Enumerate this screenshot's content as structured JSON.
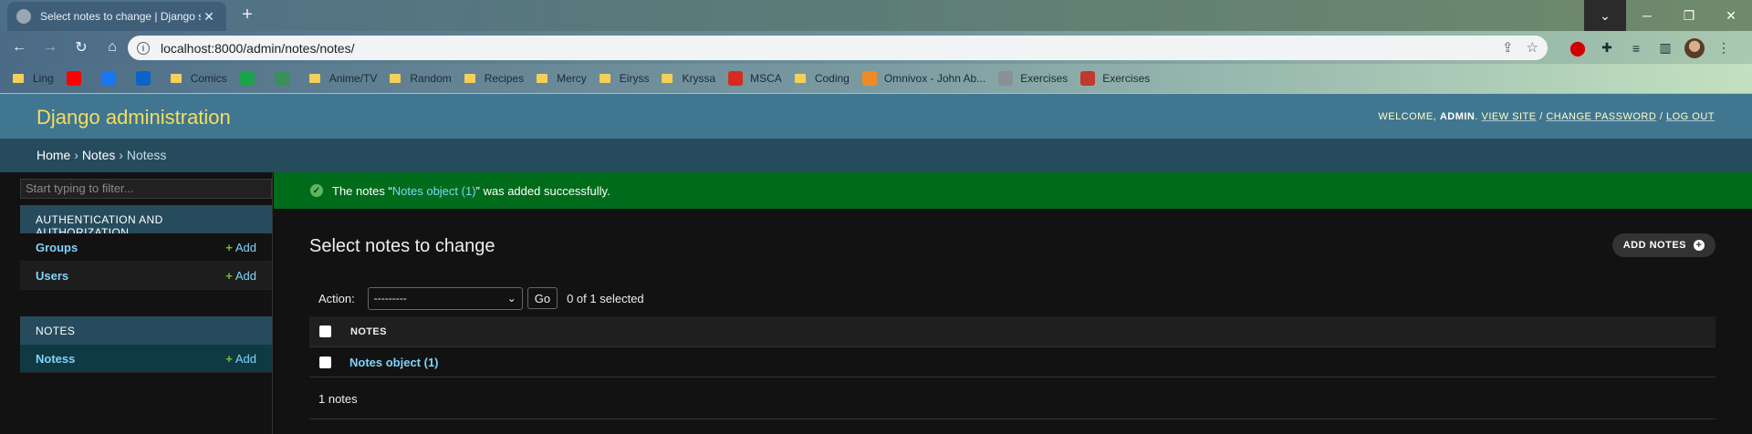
{
  "browser": {
    "tab_title": "Select notes to change | Django site admin",
    "url": "localhost:8000/admin/notes/notes/",
    "bookmarks": [
      {
        "label": "Ling",
        "icon": "folder-icon"
      },
      {
        "label": "",
        "icon": "youtube-icon",
        "color": "#ff0000"
      },
      {
        "label": "",
        "icon": "facebook-icon",
        "color": "#1877f2"
      },
      {
        "label": "",
        "icon": "outlook-icon",
        "color": "#0a64c8"
      },
      {
        "label": "Comics",
        "icon": "folder-icon"
      },
      {
        "label": "",
        "icon": "green-app-icon",
        "color": "#1aa34a"
      },
      {
        "label": "",
        "icon": "chart-icon",
        "color": "#3a8f5a"
      },
      {
        "label": "Anime/TV",
        "icon": "folder-icon"
      },
      {
        "label": "Random",
        "icon": "folder-icon"
      },
      {
        "label": "Recipes",
        "icon": "folder-icon"
      },
      {
        "label": "Mercy",
        "icon": "folder-icon"
      },
      {
        "label": "Eiryss",
        "icon": "folder-icon"
      },
      {
        "label": "Kryssa",
        "icon": "folder-icon"
      },
      {
        "label": "MSCA",
        "icon": "maple-leaf-icon",
        "color": "#d52b1e"
      },
      {
        "label": "Coding",
        "icon": "folder-icon"
      },
      {
        "label": "Omnivox - John Ab...",
        "icon": "omnivox-icon",
        "color": "#f08a24"
      },
      {
        "label": "Exercises",
        "icon": "globe-icon",
        "color": "#8a8f98"
      },
      {
        "label": "Exercises",
        "icon": "site-icon",
        "color": "#c0392b"
      }
    ]
  },
  "header": {
    "site_title": "Django administration",
    "welcome": "WELCOME,",
    "username": "ADMIN",
    "view_site": "VIEW SITE",
    "change_password": "CHANGE PASSWORD",
    "log_out": "LOG OUT",
    "sep": "/"
  },
  "breadcrumbs": {
    "home": "Home",
    "app": "Notes",
    "model": "Notess",
    "sep": "›"
  },
  "sidebar": {
    "filter_placeholder": "Start typing to filter...",
    "apps": [
      {
        "caption": "Authentication and Authorization",
        "models": [
          {
            "name": "Groups",
            "add": "Add"
          },
          {
            "name": "Users",
            "add": "Add"
          }
        ]
      },
      {
        "caption": "Notes",
        "models": [
          {
            "name": "Notess",
            "add": "Add"
          }
        ]
      }
    ]
  },
  "main": {
    "message_prefix": "The notes “",
    "message_link": "Notes object (1)",
    "message_suffix": "” was added successfully.",
    "title": "Select notes to change",
    "add_button": "ADD NOTES",
    "action_label": "Action:",
    "action_selected": "---------",
    "go": "Go",
    "counter": "0 of 1 selected",
    "column": "NOTES",
    "rows": [
      "Notes object (1)"
    ],
    "paginator": "1 notes"
  }
}
